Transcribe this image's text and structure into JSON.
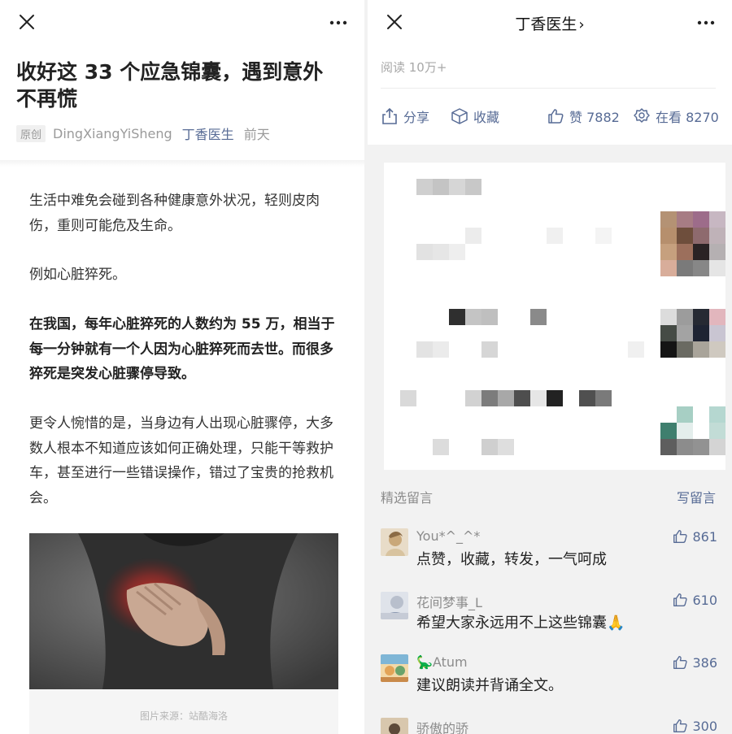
{
  "left": {
    "article": {
      "title": "收好这 33 个应急锦囊，遇到意外不再慌",
      "original_tag": "原创",
      "author": "DingXiangYiSheng",
      "account": "丁香医生",
      "time": "前天",
      "paragraphs": [
        "生活中难免会碰到各种健康意外状况，轻则皮肉伤，重则可能危及生命。",
        "例如心脏猝死。",
        "在我国，每年心脏猝死的人数约为 55 万，相当于每一分钟就有一个人因为心脏猝死而去世。而很多猝死是突发心脏骤停导致。",
        "更令人惋惜的是，当身边有人出现心脏骤停，大多数人根本不知道应该如何正确处理，只能干等救护车，甚至进行一些错误操作，错过了宝贵的抢救机会。"
      ],
      "image_caption": "图片来源：站酷海洛"
    }
  },
  "right": {
    "nav_title": "丁香医生",
    "reads": "阅读 10万+",
    "actions": {
      "share": "分享",
      "collect": "收藏",
      "like": "赞 7882",
      "watching": "在看 8270"
    },
    "comments_header": "精选留言",
    "write_comment": "写留言",
    "comments": [
      {
        "name": "You*^_^*",
        "text": "点赞，收藏，转发，一气呵成",
        "likes": "861"
      },
      {
        "name": "花间梦事_L",
        "text": "希望大家永远用不上这些锦囊🙏",
        "likes": "610"
      },
      {
        "name": "🦕Atum",
        "text": "建议朗读并背诵全文。",
        "likes": "386"
      },
      {
        "name": "骄傲的骄",
        "text": "",
        "likes": "300"
      }
    ]
  },
  "colors": {
    "link": "#576b95",
    "muted": "#9a9a9a",
    "pane_bg": "#f2f2f2",
    "heart_glow": "#d8302c"
  },
  "icons": [
    "close-icon",
    "more-icon",
    "share-icon",
    "collect-icon",
    "thumbs-up-icon",
    "watching-icon",
    "chevron-right-icon"
  ]
}
